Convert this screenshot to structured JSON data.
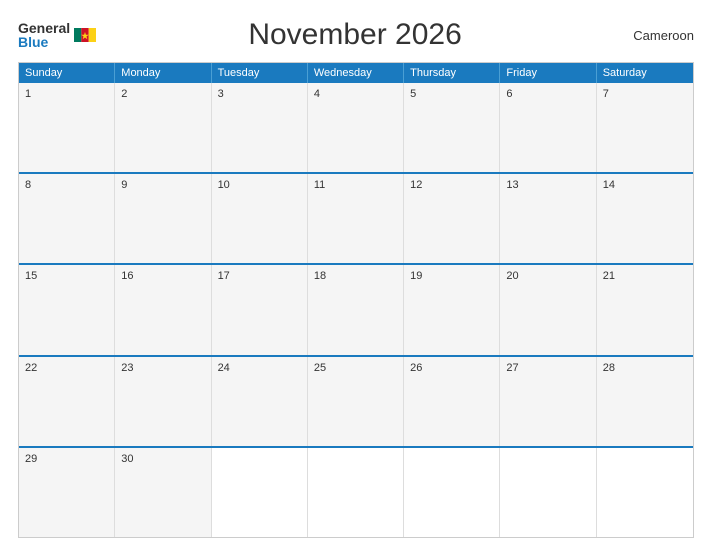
{
  "header": {
    "logo_general": "General",
    "logo_blue": "Blue",
    "title": "November 2026",
    "country": "Cameroon"
  },
  "days": [
    "Sunday",
    "Monday",
    "Tuesday",
    "Wednesday",
    "Thursday",
    "Friday",
    "Saturday"
  ],
  "weeks": [
    [
      {
        "num": "1",
        "empty": false
      },
      {
        "num": "2",
        "empty": false
      },
      {
        "num": "3",
        "empty": false
      },
      {
        "num": "4",
        "empty": false
      },
      {
        "num": "5",
        "empty": false
      },
      {
        "num": "6",
        "empty": false
      },
      {
        "num": "7",
        "empty": false
      }
    ],
    [
      {
        "num": "8",
        "empty": false
      },
      {
        "num": "9",
        "empty": false
      },
      {
        "num": "10",
        "empty": false
      },
      {
        "num": "11",
        "empty": false
      },
      {
        "num": "12",
        "empty": false
      },
      {
        "num": "13",
        "empty": false
      },
      {
        "num": "14",
        "empty": false
      }
    ],
    [
      {
        "num": "15",
        "empty": false
      },
      {
        "num": "16",
        "empty": false
      },
      {
        "num": "17",
        "empty": false
      },
      {
        "num": "18",
        "empty": false
      },
      {
        "num": "19",
        "empty": false
      },
      {
        "num": "20",
        "empty": false
      },
      {
        "num": "21",
        "empty": false
      }
    ],
    [
      {
        "num": "22",
        "empty": false
      },
      {
        "num": "23",
        "empty": false
      },
      {
        "num": "24",
        "empty": false
      },
      {
        "num": "25",
        "empty": false
      },
      {
        "num": "26",
        "empty": false
      },
      {
        "num": "27",
        "empty": false
      },
      {
        "num": "28",
        "empty": false
      }
    ],
    [
      {
        "num": "29",
        "empty": false
      },
      {
        "num": "30",
        "empty": false
      },
      {
        "num": "",
        "empty": true
      },
      {
        "num": "",
        "empty": true
      },
      {
        "num": "",
        "empty": true
      },
      {
        "num": "",
        "empty": true
      },
      {
        "num": "",
        "empty": true
      }
    ]
  ]
}
